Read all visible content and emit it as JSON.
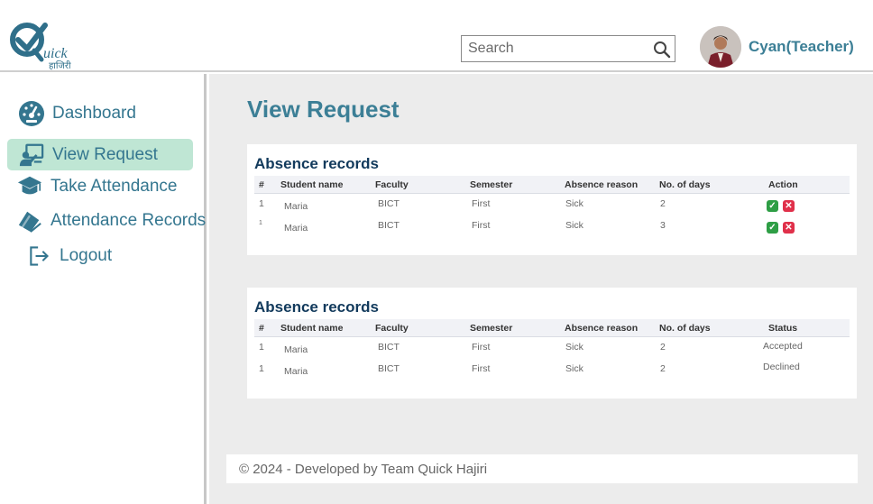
{
  "header": {
    "logo": {
      "word": "uick",
      "subtitle": "हाजिरी"
    },
    "search": {
      "placeholder": "Search",
      "icon": "search-icon"
    },
    "user": {
      "name": "Cyan(Teacher)",
      "avatar": "user-avatar"
    }
  },
  "sidebar": {
    "items": [
      {
        "label": "Dashboard",
        "icon": "speedometer-icon",
        "active": false
      },
      {
        "label": "View Request",
        "icon": "teacher-board-icon",
        "active": true
      },
      {
        "label": "Take Attendance",
        "icon": "graduation-cap-icon",
        "active": false
      },
      {
        "label": "Attendance Records",
        "icon": "book-stack-icon",
        "active": false
      },
      {
        "label": "Logout",
        "icon": "logout-icon",
        "active": false
      }
    ]
  },
  "main": {
    "title": "View Request",
    "pending": {
      "title": "Absence records",
      "columns": [
        "#",
        "Student name",
        "Faculty",
        "Semester",
        "Absence reason",
        "No. of days",
        "Action"
      ],
      "rows": [
        {
          "num": "1",
          "name": "Maria",
          "faculty": "BICT",
          "semester": "First",
          "reason": "Sick",
          "days": "2"
        },
        {
          "num": "1",
          "name": "Maria",
          "faculty": "BICT",
          "semester": "First",
          "reason": "Sick",
          "days": "3"
        }
      ],
      "actions": {
        "accept_icon": "check-icon",
        "decline_icon": "close-icon"
      }
    },
    "history": {
      "title": "Absence records",
      "columns": [
        "#",
        "Student name",
        "Faculty",
        "Semester",
        "Absence reason",
        "No. of days",
        "Status"
      ],
      "rows": [
        {
          "num": "1",
          "name": "Maria",
          "faculty": "BICT",
          "semester": "First",
          "reason": "Sick",
          "days": "2",
          "status": "Accepted"
        },
        {
          "num": "1",
          "name": "Maria",
          "faculty": "BICT",
          "semester": "First",
          "reason": "Sick",
          "days": "2",
          "status": "Declined"
        }
      ]
    }
  },
  "footer": {
    "text": "© 2024 - Developed by Team Quick Hajiri"
  },
  "colors": {
    "accent": "#3c7f96",
    "active_bg": "#bfe6d4",
    "accept": "#2e9e45",
    "decline": "#e0304a",
    "content_bg": "#ececec"
  }
}
